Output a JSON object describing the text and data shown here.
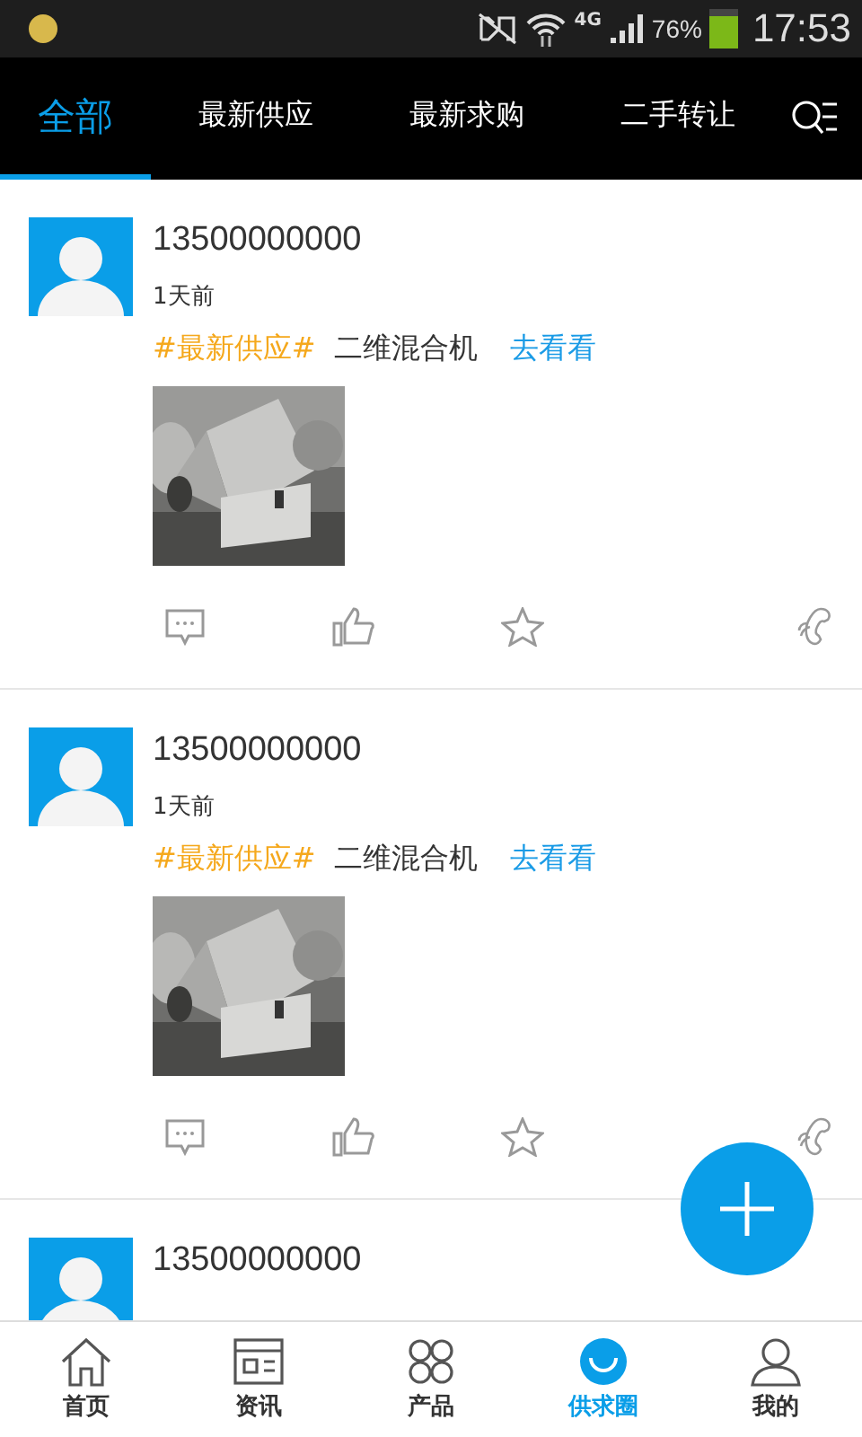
{
  "status_bar": {
    "network": "4G",
    "battery": "76%",
    "time": "17:53"
  },
  "tabs": [
    {
      "label": "全部",
      "selected": true
    },
    {
      "label": "最新供应",
      "selected": false
    },
    {
      "label": "最新求购",
      "selected": false
    },
    {
      "label": "二手转让",
      "selected": false
    }
  ],
  "posts": [
    {
      "user": "13500000000",
      "time": "1天前",
      "tag": "#最新供应#",
      "title": "二维混合机",
      "link": "去看看"
    },
    {
      "user": "13500000000",
      "time": "1天前",
      "tag": "#最新供应#",
      "title": "二维混合机",
      "link": "去看看"
    },
    {
      "user": "13500000000"
    }
  ],
  "bottom_nav": [
    {
      "label": "首页",
      "selected": false
    },
    {
      "label": "资讯",
      "selected": false
    },
    {
      "label": "产品",
      "selected": false
    },
    {
      "label": "供求圈",
      "selected": true
    },
    {
      "label": "我的",
      "selected": false
    }
  ]
}
